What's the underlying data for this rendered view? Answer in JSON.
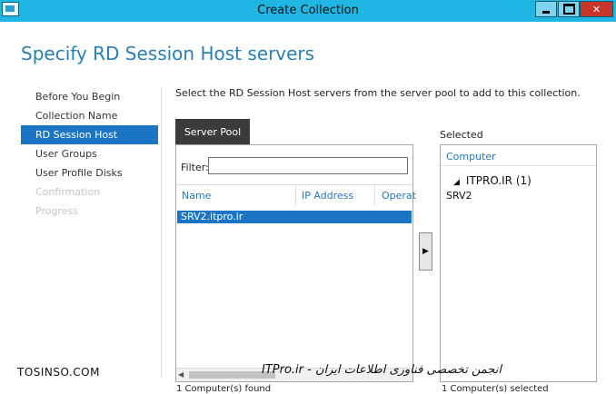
{
  "window": {
    "title": "Create Collection",
    "minimize_icon": "minimize-icon",
    "maximize_icon": "maximize-icon",
    "close_glyph": "✕"
  },
  "page": {
    "heading": "Specify RD Session Host servers",
    "instruction": "Select the RD Session Host servers from the server pool to add to this collection."
  },
  "nav": {
    "items": [
      {
        "label": "Before You Begin",
        "state": "normal"
      },
      {
        "label": "Collection Name",
        "state": "normal"
      },
      {
        "label": "RD Session Host",
        "state": "active"
      },
      {
        "label": "User Groups",
        "state": "normal"
      },
      {
        "label": "User Profile Disks",
        "state": "normal"
      },
      {
        "label": "Confirmation",
        "state": "disabled"
      },
      {
        "label": "Progress",
        "state": "disabled"
      }
    ]
  },
  "server_pool": {
    "tab_label": "Server Pool",
    "filter_label": "Filter:",
    "filter_value": "",
    "columns": [
      "Name",
      "IP Address",
      "Operat"
    ],
    "rows": [
      {
        "name": "SRV2.itpro.ir"
      }
    ],
    "footer": "1 Computer(s) found"
  },
  "add_button": {
    "glyph": "▶"
  },
  "selected": {
    "label": "Selected",
    "column": "Computer",
    "group": {
      "toggle_glyph": "◢",
      "label": "ITPRO.IR (1)"
    },
    "items": [
      "SRV2"
    ],
    "footer": "1 Computer(s) selected"
  },
  "watermarks": {
    "left": "TOSINSO.COM",
    "right": "ITPro.ir - انجمن تخصصی فناوری اطلاعات ایران"
  },
  "colors": {
    "titlebar": "#1fb6e4",
    "heading": "#2a7fb0",
    "selection": "#1a76c5",
    "tab": "#3b3b3b",
    "close_button": "#c8352b"
  }
}
